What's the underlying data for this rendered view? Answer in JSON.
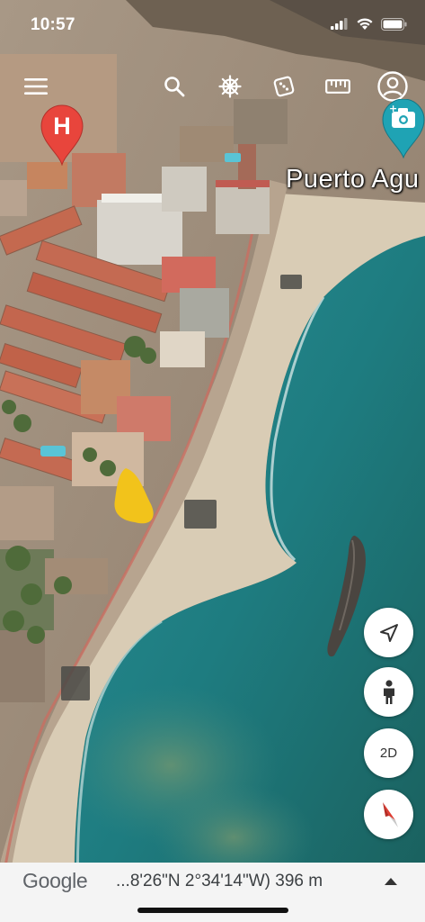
{
  "status_bar": {
    "time": "10:57",
    "signal_icon": "cellular-signal-icon",
    "wifi_icon": "wifi-icon",
    "battery_icon": "battery-icon"
  },
  "toolbar": {
    "menu_icon": "hamburger-menu-icon",
    "search_icon": "search-icon",
    "voyager_icon": "ship-wheel-icon",
    "feeling_lucky_icon": "dice-icon",
    "measure_icon": "ruler-icon",
    "account_icon": "account-circle-icon"
  },
  "map": {
    "view": "3D satellite",
    "place_label": "Puerto Agu",
    "hotel_pin_letter": "H",
    "hotel_pin_color": "#e8453c",
    "photo_pin_color": "#1fa3b4",
    "sea_color": "#1f8a8e",
    "beach_color": "#d8cbb4"
  },
  "controls": {
    "locate_icon": "navigation-arrow-icon",
    "street_view_icon": "pegman-icon",
    "view_mode_label": "2D",
    "compass_icon": "compass-icon"
  },
  "bottom_bar": {
    "logo": "Google",
    "coordinates": "...8'26\"N 2°34'14\"W) 396 m",
    "expand_icon": "triangle-up-icon"
  }
}
